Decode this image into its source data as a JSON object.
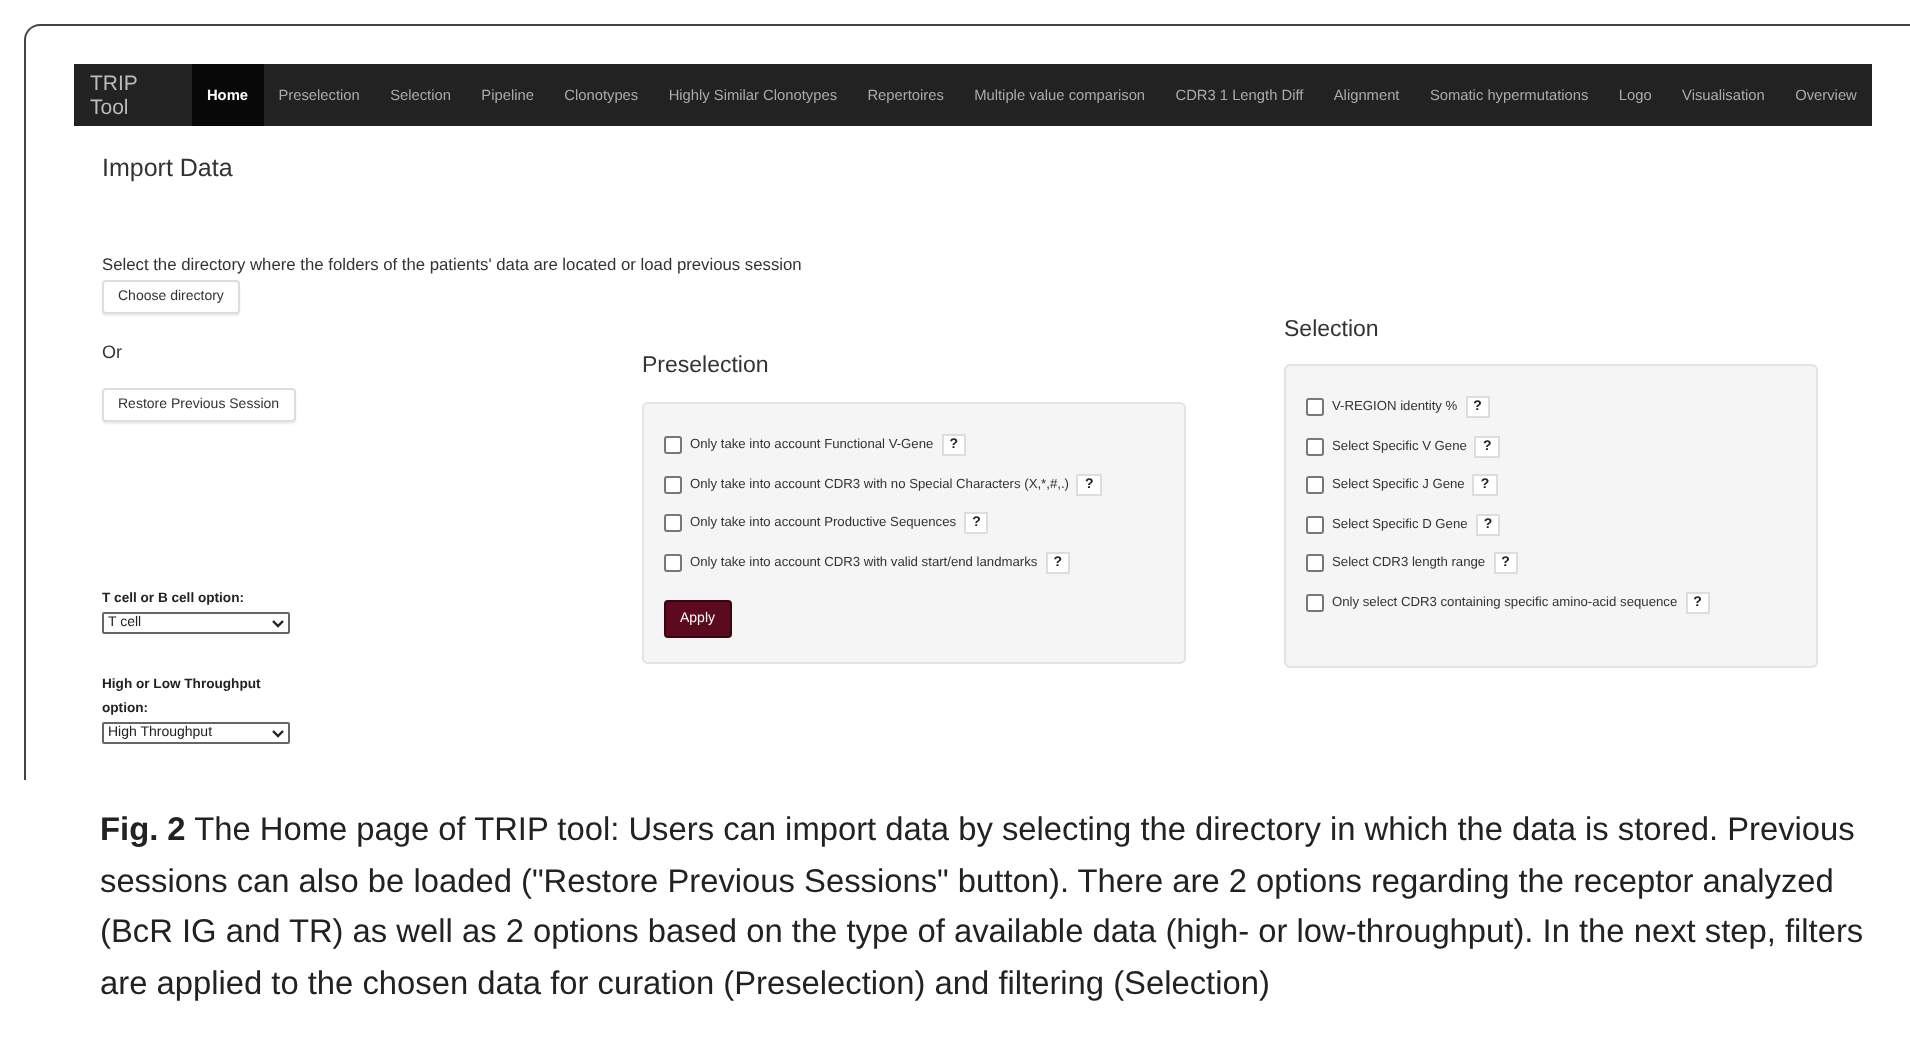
{
  "nav": {
    "brand": "TRIP Tool",
    "items": [
      {
        "label": "Home",
        "selected": true
      },
      {
        "label": "Preselection",
        "selected": false
      },
      {
        "label": "Selection",
        "selected": false
      },
      {
        "label": "Pipeline",
        "selected": false
      },
      {
        "label": "Clonotypes",
        "selected": false
      },
      {
        "label": "Highly Similar Clonotypes",
        "selected": false
      },
      {
        "label": "Repertoires",
        "selected": false
      },
      {
        "label": "Multiple value comparison",
        "selected": false
      },
      {
        "label": "CDR3 1 Length Diff",
        "selected": false
      },
      {
        "label": "Alignment",
        "selected": false
      },
      {
        "label": "Somatic hypermutations",
        "selected": false
      },
      {
        "label": "Logo",
        "selected": false
      },
      {
        "label": "Visualisation",
        "selected": false
      },
      {
        "label": "Overview",
        "selected": false
      }
    ]
  },
  "import": {
    "title": "Import Data",
    "description": "Select the directory where the folders of the patients' data are located or load previous session",
    "choose_button": "Choose directory",
    "or_text": "Or",
    "restore_button": "Restore Previous Session"
  },
  "cell_option": {
    "label": "T cell or B cell option:",
    "value": "T cell"
  },
  "throughput_option": {
    "label": "High or Low Throughput option:",
    "value": "High Throughput"
  },
  "preselection": {
    "title": "Preselection",
    "options": [
      {
        "label": "Only take into account Functional V-Gene",
        "checked": false,
        "help": "?"
      },
      {
        "label": "Only take into account CDR3 with no Special Characters (X,*,#,.)",
        "checked": false,
        "help": "?"
      },
      {
        "label": "Only take into account Productive Sequences",
        "checked": false,
        "help": "?"
      },
      {
        "label": "Only take into account CDR3 with valid start/end landmarks",
        "checked": false,
        "help": "?"
      }
    ],
    "apply_button": "Apply"
  },
  "selection": {
    "title": "Selection",
    "options": [
      {
        "label": "V-REGION identity %",
        "checked": false,
        "help": "?"
      },
      {
        "label": "Select Specific V Gene",
        "checked": false,
        "help": "?"
      },
      {
        "label": "Select Specific J Gene",
        "checked": false,
        "help": "?"
      },
      {
        "label": "Select Specific D Gene",
        "checked": false,
        "help": "?"
      },
      {
        "label": "Select CDR3 length range",
        "checked": false,
        "help": "?"
      },
      {
        "label": "Only select CDR3 containing specific amino-acid sequence",
        "checked": false,
        "help": "?"
      }
    ]
  },
  "caption": "**Fig. 2**  The Home page of TRIP tool: Users can import data by selecting the directory in which the data is stored. Previous sessions can also be loaded (\"Restore Previous Sessions\" button). There are 2 options regarding the receptor analyzed (BcR IG and TR) as well as 2 options based on the type of available data (high- or low-throughput). In the next step, filters are applied to the chosen data for curation (Preselection) and filtering (Selection)"
}
